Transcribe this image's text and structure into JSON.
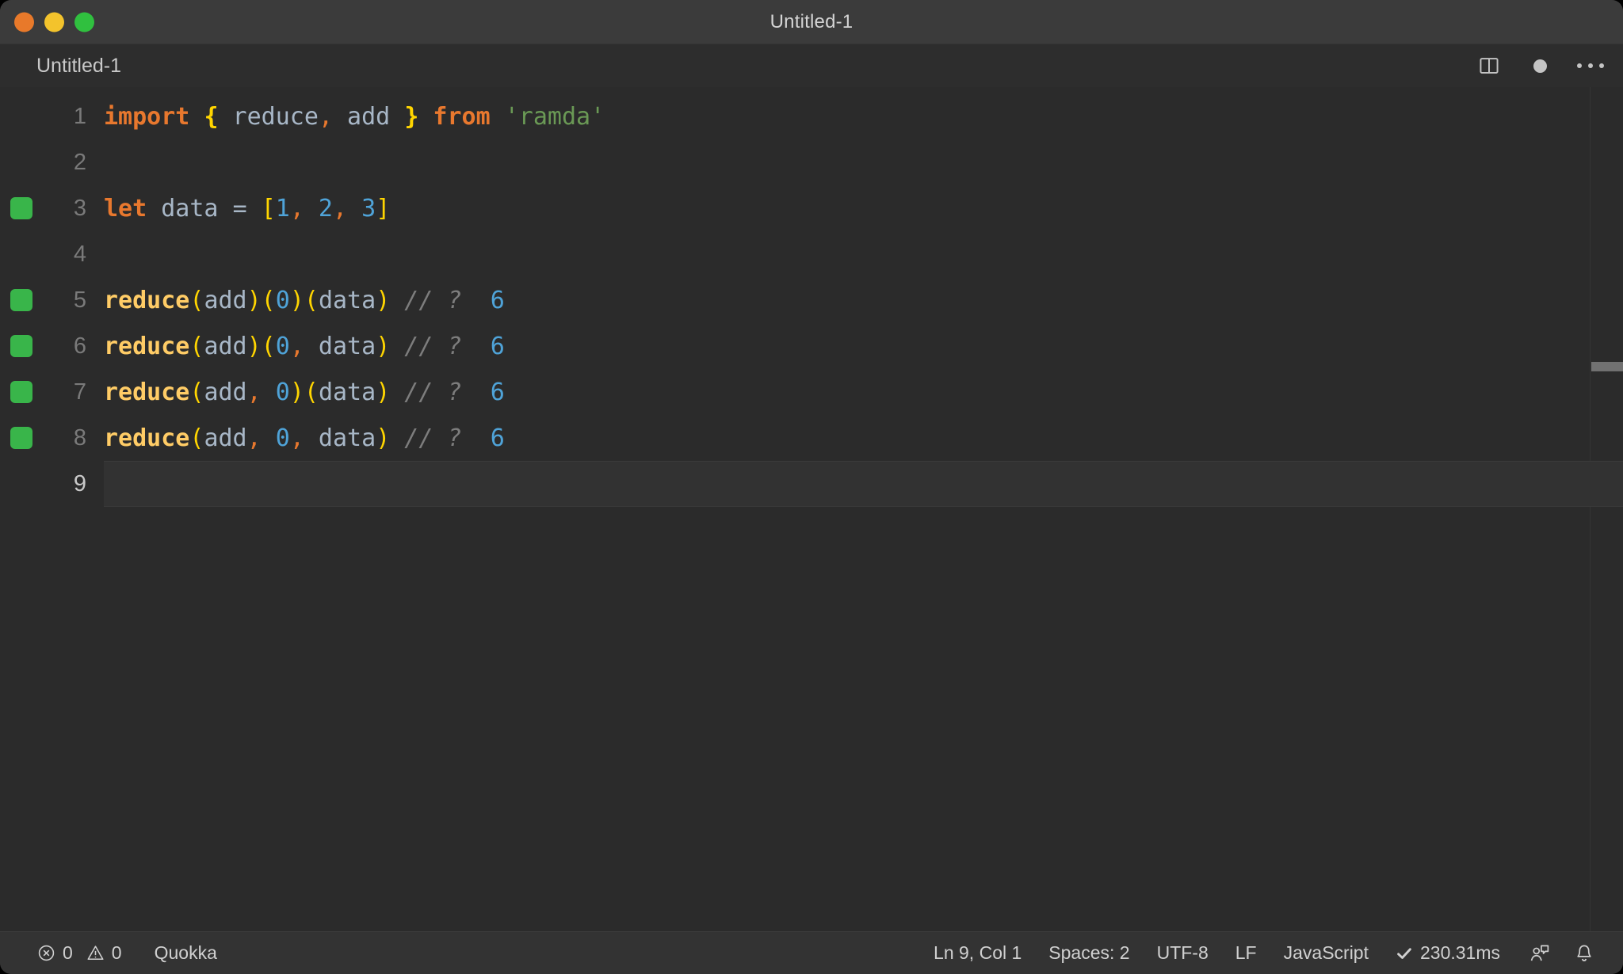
{
  "window": {
    "title": "Untitled-1",
    "traffic_lights": [
      {
        "name": "close-button",
        "color": "#e8792a"
      },
      {
        "name": "minimize-button",
        "color": "#f3c32c"
      },
      {
        "name": "zoom-button",
        "color": "#30c03f"
      }
    ]
  },
  "tabstrip": {
    "tab_label": "Untitled-1",
    "actions": [
      {
        "name": "split-editor-icon",
        "icon": "split-editor"
      },
      {
        "name": "unsaved-indicator",
        "icon": "filled-dot"
      },
      {
        "name": "more-actions-icon",
        "icon": "ellipsis"
      }
    ]
  },
  "editor": {
    "language": "JavaScript",
    "lines": [
      {
        "num": "1",
        "covered": false,
        "active": false
      },
      {
        "num": "2",
        "covered": false,
        "active": false
      },
      {
        "num": "3",
        "covered": true,
        "active": false
      },
      {
        "num": "4",
        "covered": false,
        "active": false
      },
      {
        "num": "5",
        "covered": true,
        "active": false
      },
      {
        "num": "6",
        "covered": true,
        "active": false
      },
      {
        "num": "7",
        "covered": true,
        "active": false
      },
      {
        "num": "8",
        "covered": true,
        "active": false
      },
      {
        "num": "9",
        "covered": false,
        "active": true
      }
    ],
    "code": {
      "l1": {
        "kw_import": "import",
        "brace_open": "{",
        "id_reduce": " reduce",
        "comma": ",",
        "id_add": " add ",
        "brace_close": "}",
        "kw_from": " from ",
        "str_ramda": "'ramda'"
      },
      "l3": {
        "kw_let": "let",
        "id_data": " data ",
        "op_eq": "= ",
        "bracket_open": "[",
        "n1": "1",
        "c1": ",",
        "n2": " 2",
        "c2": ",",
        "n3": " 3",
        "bracket_close": "]"
      },
      "l5": {
        "fn": "reduce",
        "p1": "(",
        "arg1": "add",
        "p2": ")(",
        "arg2": "0",
        "p3": ")(",
        "arg3": "data",
        "p4": ")",
        "comment": " // ?",
        "value": "6"
      },
      "l6": {
        "fn": "reduce",
        "p1": "(",
        "arg1": "add",
        "p2": ")(",
        "arg2": "0",
        "comma": ",",
        "arg3": " data",
        "p4": ")",
        "comment": " // ?",
        "value": "6"
      },
      "l7": {
        "fn": "reduce",
        "p1": "(",
        "arg1": "add",
        "comma": ",",
        "arg2": " 0",
        "p2": ")(",
        "arg3": "data",
        "p4": ")",
        "comment": " // ?",
        "value": "6"
      },
      "l8": {
        "fn": "reduce",
        "p1": "(",
        "arg1": "add",
        "comma1": ",",
        "arg2": " 0",
        "comma2": ",",
        "arg3": " data",
        "p4": ")",
        "comment": " // ?",
        "value": "6"
      }
    }
  },
  "statusbar": {
    "errors_count": "0",
    "warnings_count": "0",
    "extension": "Quokka",
    "cursor_position": "Ln 9, Col 1",
    "indentation": "Spaces: 2",
    "encoding": "UTF-8",
    "eol": "LF",
    "language_mode": "JavaScript",
    "run_time": "230.31ms",
    "run_status_icon": "check",
    "feedback_icon": "person-speech-bubble",
    "notifications_icon": "bell"
  },
  "colors": {
    "titlebar_bg": "#3b3b3b",
    "editor_bg": "#2b2b2b",
    "statusbar_bg": "#333333",
    "coverage_green": "#39b54a",
    "keyword_orange": "#e8782e",
    "function_gold": "#ffcc66",
    "bracket_yellow": "#ffd500",
    "identifier_gray": "#a8b7c7",
    "number_blue": "#4fa3d8",
    "string_green": "#6a9955",
    "comment_gray": "#7d7d7d"
  }
}
